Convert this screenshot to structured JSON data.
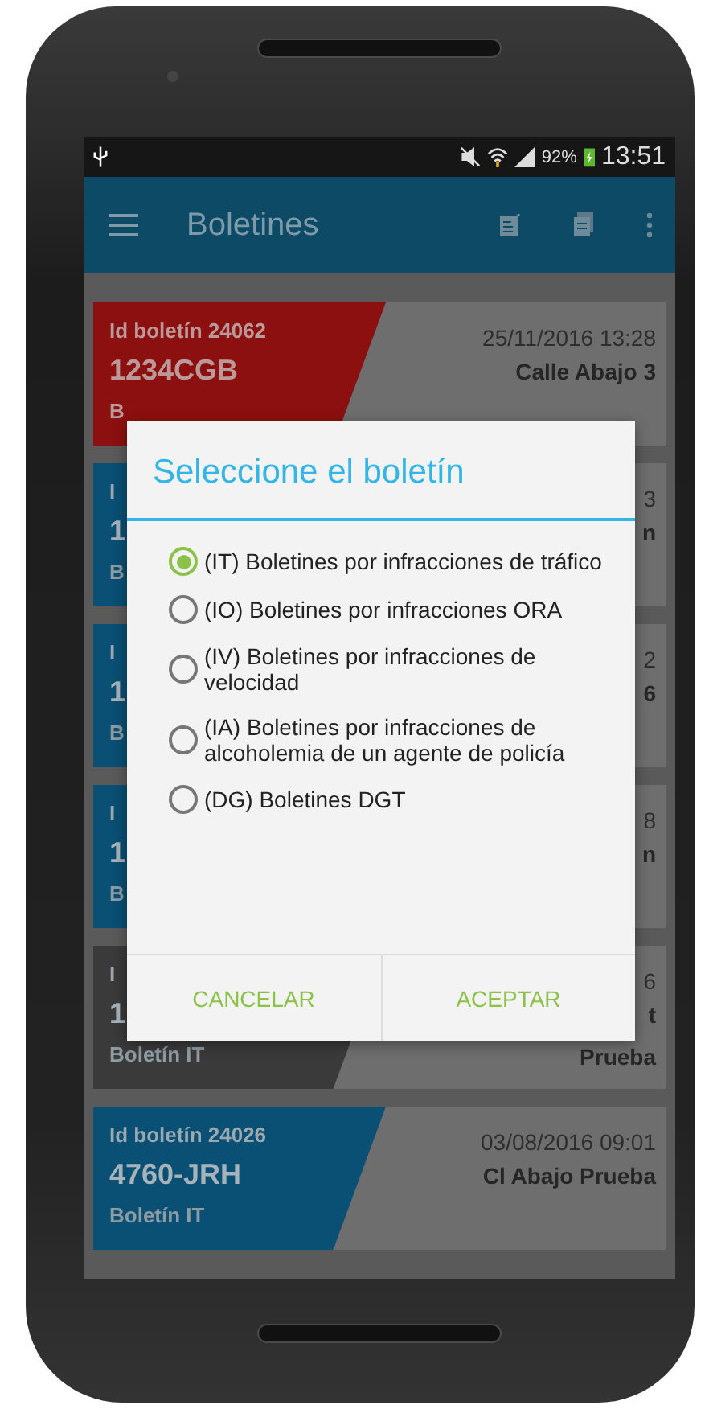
{
  "status_bar": {
    "battery": "92%",
    "time": "13:51"
  },
  "app_bar": {
    "title": "Boletines"
  },
  "cards": [
    {
      "color": "#8c1010",
      "id": "Id boletín 24062",
      "plate": "1234CGB",
      "type": "B",
      "date": "25/11/2016 13:28",
      "address": "Calle Abajo 3"
    },
    {
      "color": "#0a4f74",
      "id": "I",
      "plate": "1",
      "type": "B",
      "date": "3",
      "address": "n"
    },
    {
      "color": "#0a4f74",
      "id": "I",
      "plate": "1",
      "type": "B",
      "date": "2",
      "address": "6"
    },
    {
      "color": "#0a4f74",
      "id": "I",
      "plate": "1",
      "type": "B",
      "date": "8",
      "address": "n"
    },
    {
      "color": "#3a3a3a",
      "id": "I",
      "plate": "1",
      "type": "Boletín IT",
      "date": "6",
      "address": "t",
      "address2": "Prueba"
    },
    {
      "color": "#0a4f74",
      "id": "Id boletín 24026",
      "plate": "4760-JRH",
      "type": "Boletín IT",
      "date": "03/08/2016 09:01",
      "address": "Cl Abajo Prueba"
    }
  ],
  "dialog": {
    "title": "Seleccione el boletín",
    "options": [
      {
        "label": "(IT) Boletines por infracciones de tráfico",
        "selected": true
      },
      {
        "label": "(IO) Boletines por infracciones ORA",
        "selected": false
      },
      {
        "label": "(IV) Boletines por infracciones de velocidad",
        "selected": false
      },
      {
        "label": "(IA) Boletines por infracciones de alcoholemia de un agente de policía",
        "selected": false
      },
      {
        "label": "(DG) Boletines DGT",
        "selected": false
      }
    ],
    "buttons": [
      "CANCELAR",
      "ACEPTAR"
    ]
  }
}
